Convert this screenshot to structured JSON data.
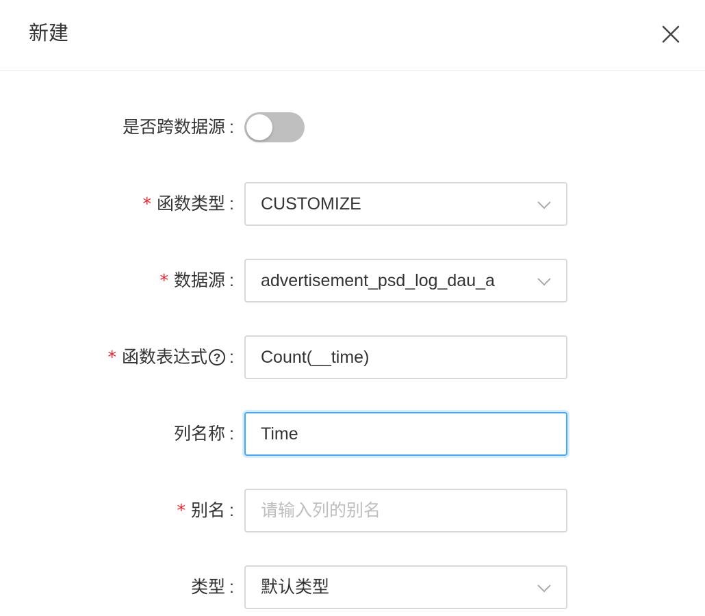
{
  "modal": {
    "title": "新建",
    "close_icon": "close-icon"
  },
  "form": {
    "cross_source": {
      "label": "是否跨数据源",
      "colon": ":",
      "enabled": false
    },
    "function_type": {
      "label": "函数类型",
      "colon": ":",
      "required": "*",
      "value": "CUSTOMIZE"
    },
    "data_source": {
      "label": "数据源",
      "colon": ":",
      "required": "*",
      "value": "advertisement_psd_log_dau_a"
    },
    "expression": {
      "label": "函数表达式",
      "colon": ":",
      "required": "*",
      "help_glyph": "?",
      "value": "Count(__time)"
    },
    "column_name": {
      "label": "列名称",
      "colon": ":",
      "value": "Time"
    },
    "alias": {
      "label": "别名",
      "colon": ":",
      "required": "*",
      "value": "",
      "placeholder": "请输入列的别名"
    },
    "type": {
      "label": "类型",
      "colon": ":",
      "value": "默认类型"
    }
  },
  "colors": {
    "accent": "#40a9ff",
    "required": "#f5222d",
    "switch_off": "#bfbfbf",
    "border": "#d9d9d9"
  }
}
